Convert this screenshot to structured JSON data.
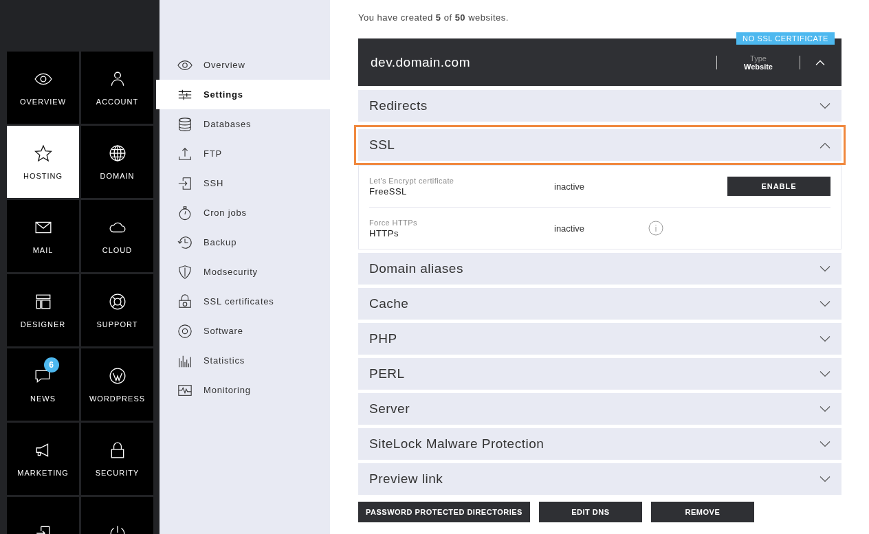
{
  "tiles": [
    {
      "label": "OVERVIEW",
      "selected": false
    },
    {
      "label": "ACCOUNT",
      "selected": false
    },
    {
      "label": "HOSTING",
      "selected": true
    },
    {
      "label": "DOMAIN",
      "selected": false
    },
    {
      "label": "MAIL",
      "selected": false
    },
    {
      "label": "CLOUD",
      "selected": false
    },
    {
      "label": "DESIGNER",
      "selected": false
    },
    {
      "label": "SUPPORT",
      "selected": false
    },
    {
      "label": "NEWS",
      "selected": false,
      "badge": "6"
    },
    {
      "label": "WORDPRESS",
      "selected": false
    },
    {
      "label": "MARKETING",
      "selected": false
    },
    {
      "label": "SECURITY",
      "selected": false
    },
    {
      "selected": false
    },
    {
      "selected": false
    }
  ],
  "menu": [
    {
      "label": "Overview",
      "selected": false
    },
    {
      "label": "Settings",
      "selected": true
    },
    {
      "label": "Databases",
      "selected": false
    },
    {
      "label": "FTP",
      "selected": false
    },
    {
      "label": "SSH",
      "selected": false
    },
    {
      "label": "Cron jobs",
      "selected": false
    },
    {
      "label": "Backup",
      "selected": false
    },
    {
      "label": "Modsecurity",
      "selected": false
    },
    {
      "label": "SSL certificates",
      "selected": false
    },
    {
      "label": "Software",
      "selected": false
    },
    {
      "label": "Statistics",
      "selected": false
    },
    {
      "label": "Monitoring",
      "selected": false
    }
  ],
  "summary": "You have created **5** of **50** websites.",
  "website": {
    "domain": "dev.domain.com",
    "badge": "NO SSL CERTIFICATE",
    "type_label": "Type",
    "type_value": "Website",
    "expanded": true
  },
  "sections": [
    {
      "title": "Redirects",
      "expanded": false,
      "highlighted": false
    },
    {
      "title": "SSL",
      "expanded": true,
      "highlighted": true,
      "rows": [
        {
          "label": "Let's Encrypt certificate",
          "name": "FreeSSL",
          "status": "inactive",
          "kind": "button",
          "action": "ENABLE"
        },
        {
          "label": "Force HTTPs",
          "name": "HTTPs",
          "status": "inactive",
          "kind": "info"
        }
      ]
    },
    {
      "title": "Domain aliases",
      "expanded": false,
      "highlighted": false
    },
    {
      "title": "Cache",
      "expanded": false,
      "highlighted": false
    },
    {
      "title": "PHP",
      "expanded": false,
      "highlighted": false
    },
    {
      "title": "PERL",
      "expanded": false,
      "highlighted": false
    },
    {
      "title": "Server",
      "expanded": false,
      "highlighted": false
    },
    {
      "title": "SiteLock Malware Protection",
      "expanded": false,
      "highlighted": false
    },
    {
      "title": "Preview link",
      "expanded": false,
      "highlighted": false
    }
  ],
  "buttons": [
    "PASSWORD PROTECTED DIRECTORIES",
    "EDIT DNS",
    "REMOVE"
  ]
}
